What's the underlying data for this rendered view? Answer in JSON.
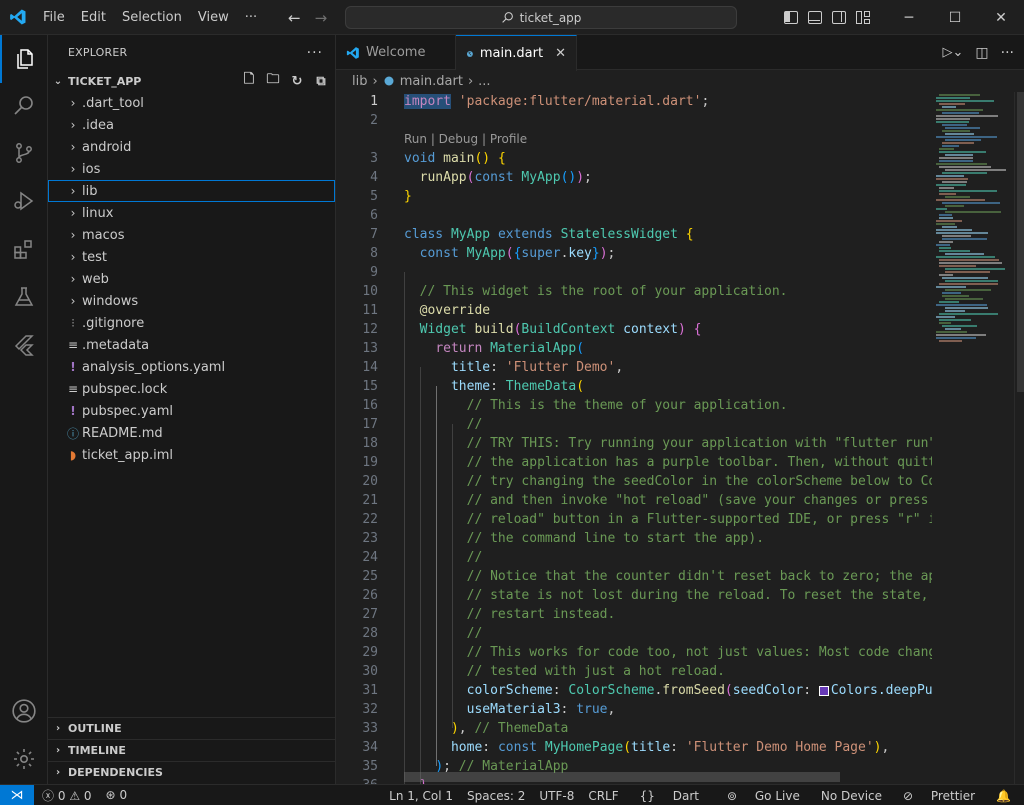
{
  "titlebar": {
    "menu": [
      "File",
      "Edit",
      "Selection",
      "View",
      "···"
    ],
    "search_text": "ticket_app",
    "accent": "#0078d4"
  },
  "activitybar": {
    "items": [
      "files-icon",
      "search-icon",
      "source-control-icon",
      "run-debug-icon",
      "extensions-icon",
      "testing-icon",
      "flutter-icon"
    ],
    "bottom": [
      "account-icon",
      "settings-icon"
    ]
  },
  "sidebar": {
    "title": "EXPLORER",
    "more": "···",
    "project": "TICKET_APP",
    "folders": [
      ".dart_tool",
      ".idea",
      "android",
      "ios",
      "lib",
      "linux",
      "macos",
      "test",
      "web",
      "windows"
    ],
    "files": [
      {
        "name": ".gitignore",
        "icon": "gitignore-icon",
        "glyph": "⁝"
      },
      {
        "name": ".metadata",
        "icon": "metadata-icon",
        "glyph": "≡"
      },
      {
        "name": "analysis_options.yaml",
        "icon": "yaml-icon",
        "glyph": "!"
      },
      {
        "name": "pubspec.lock",
        "icon": "lock-file-icon",
        "glyph": "≡"
      },
      {
        "name": "pubspec.yaml",
        "icon": "yaml-icon",
        "glyph": "!"
      },
      {
        "name": "README.md",
        "icon": "info-icon",
        "glyph": "ⓘ"
      },
      {
        "name": "ticket_app.iml",
        "icon": "rss-icon",
        "glyph": "◗"
      }
    ],
    "sections": [
      "OUTLINE",
      "TIMELINE",
      "DEPENDENCIES"
    ]
  },
  "tabs": [
    {
      "label": "Welcome",
      "active": false
    },
    {
      "label": "main.dart",
      "active": true
    }
  ],
  "breadcrumb": {
    "folder": "lib",
    "file": "main.dart",
    "rest": "..."
  },
  "codelens": "Run | Debug | Profile",
  "line_numbers": [
    "1",
    "2",
    "3",
    "4",
    "5",
    "6",
    "7",
    "8",
    "9",
    "10",
    "11",
    "12",
    "13",
    "14",
    "15",
    "16",
    "17",
    "18",
    "19",
    "20",
    "21",
    "22",
    "23",
    "24",
    "25",
    "26",
    "27",
    "28",
    "29",
    "30",
    "31",
    "32",
    "33",
    "34",
    "35",
    "36"
  ],
  "comments": {
    "c10": "// This widget is the root of your application.",
    "c16": "// This is the theme of your application.",
    "c17": "//",
    "c18": "// TRY THIS: Try running your application with \"flutter run\". You'll see",
    "c19": "// the application has a purple toolbar. Then, without quitting the app,",
    "c20": "// try changing the seedColor in the colorScheme below to Colors.green",
    "c21": "// and then invoke \"hot reload\" (save your changes or press the \"hot",
    "c22": "// reload\" button in a Flutter-supported IDE, or press \"r\" if you used",
    "c23": "// the command line to start the app).",
    "c24": "//",
    "c25": "// Notice that the counter didn't reset back to zero; the application",
    "c26": "// state is not lost during the reload. To reset the state, use hot",
    "c27": "// restart instead.",
    "c28": "//",
    "c29": "// This works for code too, not just values: Most code changes can be",
    "c30": "// tested with just a hot reload.",
    "c33": "// ThemeData",
    "c35": "// MaterialApp"
  },
  "code": {
    "import_kw": "import",
    "import_str": "'package:flutter/material.dart'",
    "title_str": "'Flutter Demo'",
    "home_str": "'Flutter Demo Home Page'",
    "seed_color": "Colors.deepPurple"
  },
  "statusbar": {
    "errors": "0",
    "warnings": "0",
    "ports": "0",
    "position": "Ln 1, Col 1",
    "spaces": "Spaces: 2",
    "encoding": "UTF-8",
    "eol": "CRLF",
    "language": "Dart",
    "golive": "Go Live",
    "device": "No Device",
    "prettier": "Prettier"
  }
}
